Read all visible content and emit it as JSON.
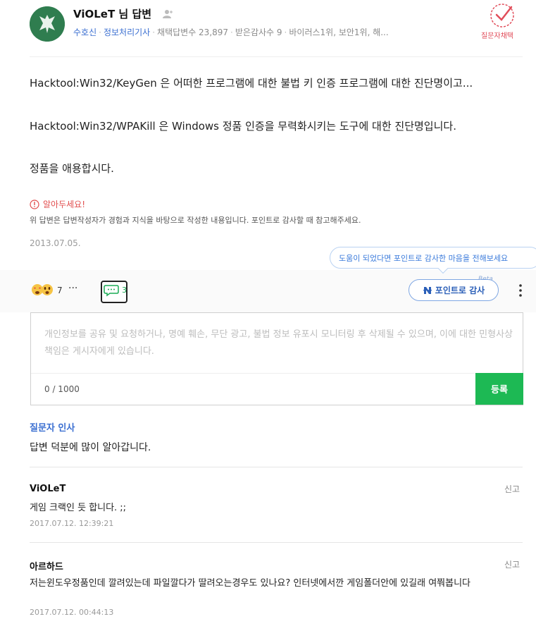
{
  "author": {
    "name": "ViOLeT",
    "suffix": " 님 답변",
    "tags": [
      "수호신",
      "정보처리기사"
    ],
    "stats": "채택답변수 23,897",
    "thanks": "받은감사수 9",
    "ranks": "바이러스1위, 보안1위, 해..."
  },
  "adopt_badge": {
    "label": "질문자채택"
  },
  "answer": {
    "lines": [
      "Hacktool:Win32/KeyGen 은 어떠한 프로그램에 대한 불법 키 인증 프로그램에 대한 진단명이고...",
      "Hacktool:Win32/WPAKill 은 Windows 정품 인증을 무력화시키는 도구에 대한 진단명입니다.",
      "정품을 애용합시다."
    ],
    "notice_title": "알아두세요!",
    "notice_desc": "위 답변은 답변작성자가 경험과 지식을 바탕으로 작성한 내용입니다. 포인트로 감사할 때 참고해주세요.",
    "date": "2013.07.05."
  },
  "tooltip": "도움이 되었다면 포인트로 감사한 마음을 전해보세요",
  "actions": {
    "reaction_count": "7",
    "more": "···",
    "comment_count": "3",
    "point_label": "포인트로 감사",
    "beta": "Beta"
  },
  "comment_input": {
    "placeholder": "개인정보를 공유 및 요청하거나, 명예 훼손, 무단 광고, 불법 정보 유포시 모니터링 후 삭제될 수 있으며, 이에 대한 민형사상 책임은 게시자에게 있습니다.",
    "counter": "0 / 1000",
    "submit": "등록"
  },
  "greeting": {
    "title": "질문자 인사",
    "text": "답변 덕분에 많이 알아갑니다."
  },
  "comments": [
    {
      "author": "ViOLeT",
      "report": "신고",
      "text": "게임 크랙인 듯 합니다. ;;",
      "date": "2017.07.12. 12:39:21"
    },
    {
      "author": "아르하드",
      "report": "신고",
      "text": "저는윈도우정품인데 깔려있는데 파일깔다가 딸려오는경우도 있나요? 인터넷에서깐 게임폴더안에 있길래 여쭤봅니다",
      "date": "2017.07.12. 00:44:13"
    }
  ],
  "colors": {
    "accent_green": "#1db954",
    "link_blue": "#3b6fd1",
    "warn_red": "#e14d4d"
  }
}
